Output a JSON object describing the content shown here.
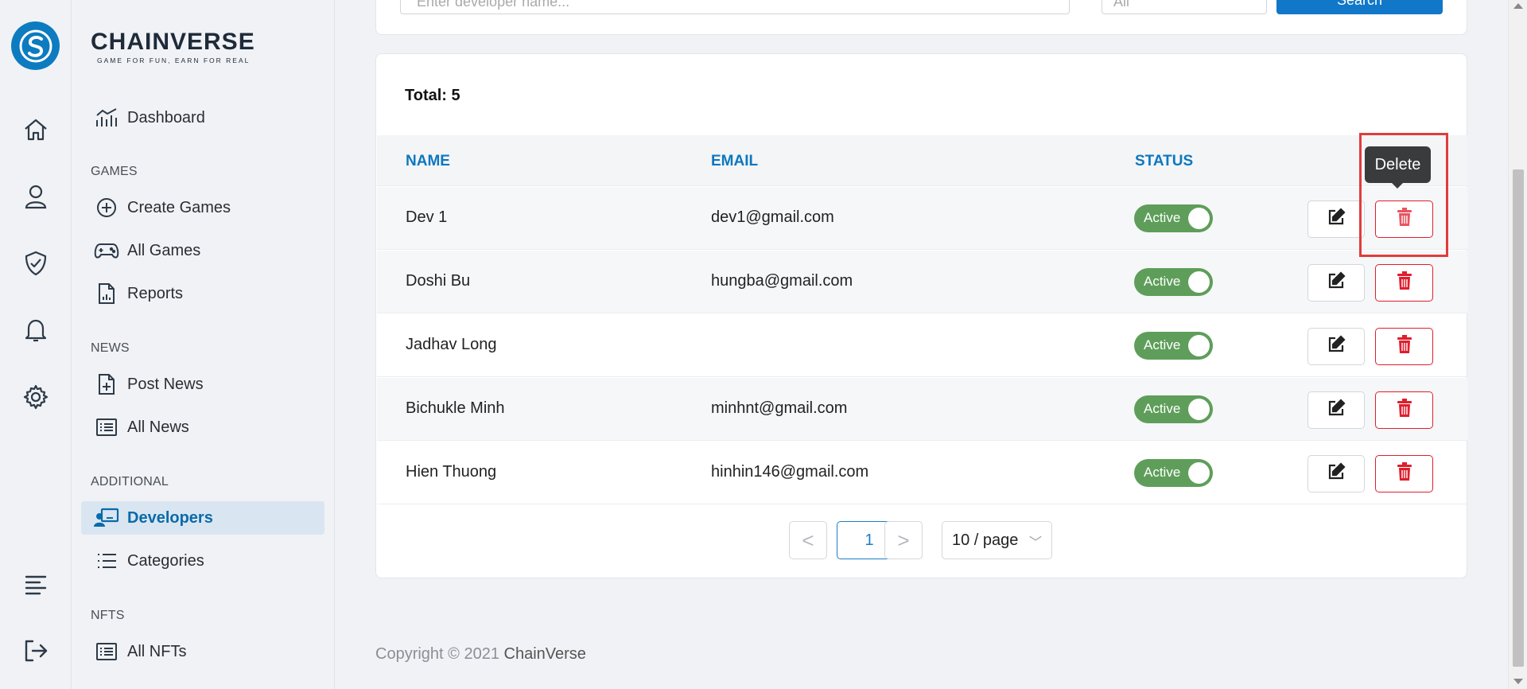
{
  "brand": {
    "name": "CHAINVERSE",
    "tagline": "GAME FOR FUN, EARN FOR REAL"
  },
  "rail": {
    "icons": [
      "home-icon",
      "user-icon",
      "shield-icon",
      "bell-icon",
      "gear-icon",
      "menu-icon",
      "logout-icon"
    ]
  },
  "sidebar": {
    "dashboard": "Dashboard",
    "sections": {
      "games": "GAMES",
      "news": "NEWS",
      "additional": "ADDITIONAL",
      "nfts": "NFTS"
    },
    "items": {
      "create_games": "Create Games",
      "all_games": "All Games",
      "reports": "Reports",
      "post_news": "Post News",
      "all_news": "All News",
      "developers": "Developers",
      "categories": "Categories",
      "all_nfts": "All NFTs"
    }
  },
  "filter": {
    "search_placeholder": "Enter developer name...",
    "status_value": "All",
    "search_button": "Search"
  },
  "table": {
    "total": "Total: 5",
    "columns": [
      "NAME",
      "EMAIL",
      "STATUS"
    ],
    "rows": [
      {
        "name": "Dev 1",
        "email": "dev1@gmail.com",
        "status": "Active"
      },
      {
        "name": "Doshi Bu",
        "email": "hungba@gmail.com",
        "status": "Active"
      },
      {
        "name": "Jadhav Long",
        "email": "",
        "status": "Active"
      },
      {
        "name": "Bichukle Minh",
        "email": "minhnt@gmail.com",
        "status": "Active"
      },
      {
        "name": "Hien Thuong",
        "email": "hinhin146@gmail.com",
        "status": "Active"
      }
    ]
  },
  "tooltip": "Delete",
  "pagination": {
    "prev": "<",
    "current": "1",
    "next": ">",
    "page_size": "10 / page"
  },
  "footer": {
    "copyright": "Copyright © 2021",
    "brand": "ChainVerse"
  },
  "colors": {
    "accent": "#1177c8",
    "active_toggle": "#5e9e5a",
    "danger": "#e01e2e"
  }
}
